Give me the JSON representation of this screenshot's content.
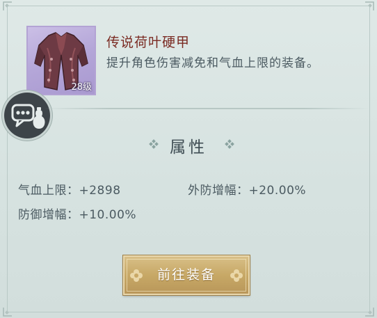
{
  "item": {
    "name": "传说荷叶硬甲",
    "description": "提升角色伤害减免和气血上限的装备。",
    "level_tag": "28级",
    "icon": "armor-vest-icon"
  },
  "chat_button": {
    "icon": "chat-bubble-icon"
  },
  "attributes": {
    "title": "属性",
    "items": [
      {
        "label": "气血上限：",
        "value": "+2898"
      },
      {
        "label": "外防增幅：",
        "value": "+20.00%"
      },
      {
        "label": "防御增幅：",
        "value": "+10.00%"
      }
    ]
  },
  "actions": {
    "equip_label": "前往装备"
  },
  "colors": {
    "item_name": "#7a2a22",
    "text": "#4b5a61",
    "button": "#c7a866",
    "rarity_frame": "#b3a3d4"
  }
}
